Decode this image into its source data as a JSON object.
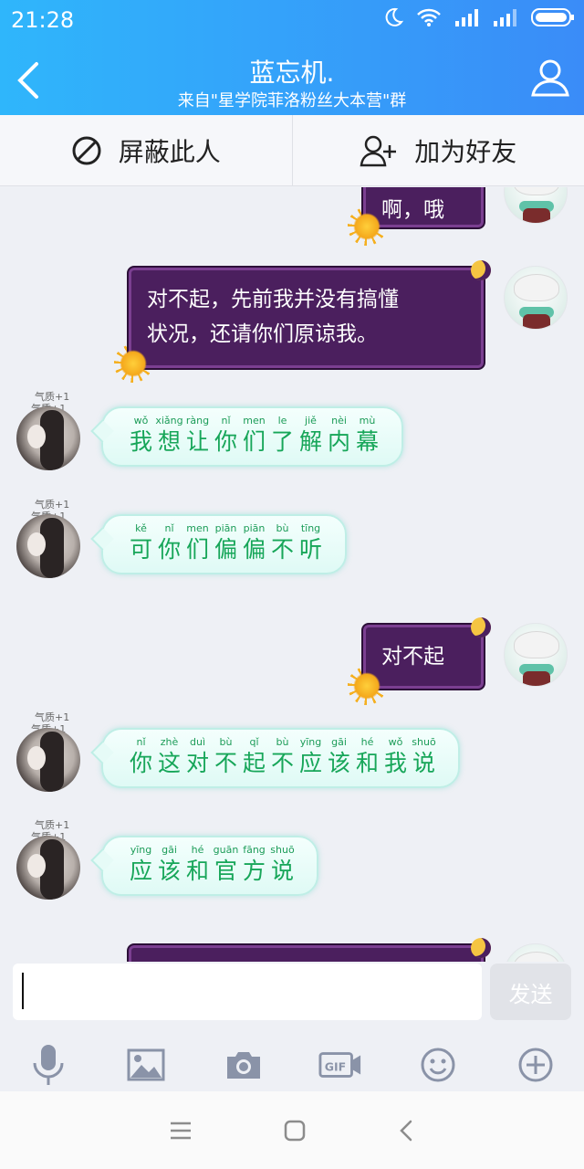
{
  "status_bar": {
    "time": "21:28"
  },
  "header": {
    "title": "蓝忘机.",
    "subtitle": "来自\"星学院菲洛粉丝大本营\"群"
  },
  "actions": {
    "block_label": "屏蔽此人",
    "add_friend_label": "加为好友"
  },
  "tags": [
    "气质+1",
    "气质+1"
  ],
  "messages": [
    {
      "side": "right",
      "text_line1": "啊，哦"
    },
    {
      "side": "right",
      "line1": "对不起，先前我并没有搞懂",
      "line2": "状况，还请你们原谅我。"
    },
    {
      "side": "left",
      "chars": [
        {
          "p": "wǒ",
          "h": "我"
        },
        {
          "p": "xiǎng",
          "h": "想"
        },
        {
          "p": "ràng",
          "h": "让"
        },
        {
          "p": "nǐ",
          "h": "你"
        },
        {
          "p": "men",
          "h": "们"
        },
        {
          "p": "le",
          "h": "了"
        },
        {
          "p": "jiě",
          "h": "解"
        },
        {
          "p": "nèi",
          "h": "内"
        },
        {
          "p": "mù",
          "h": "幕"
        }
      ]
    },
    {
      "side": "left",
      "chars": [
        {
          "p": "kě",
          "h": "可"
        },
        {
          "p": "nǐ",
          "h": "你"
        },
        {
          "p": "men",
          "h": "们"
        },
        {
          "p": "piān",
          "h": "偏"
        },
        {
          "p": "piān",
          "h": "偏"
        },
        {
          "p": "bù",
          "h": "不"
        },
        {
          "p": "tīng",
          "h": "听"
        }
      ]
    },
    {
      "side": "right",
      "text": "对不起"
    },
    {
      "side": "left",
      "chars": [
        {
          "p": "nǐ",
          "h": "你"
        },
        {
          "p": "zhè",
          "h": "这"
        },
        {
          "p": "duì",
          "h": "对"
        },
        {
          "p": "bù",
          "h": "不"
        },
        {
          "p": "qǐ",
          "h": "起"
        },
        {
          "p": "bù",
          "h": "不"
        },
        {
          "p": "yīng",
          "h": "应"
        },
        {
          "p": "gāi",
          "h": "该"
        },
        {
          "p": "hé",
          "h": "和"
        },
        {
          "p": "wǒ",
          "h": "我"
        },
        {
          "p": "shuō",
          "h": "说"
        }
      ]
    },
    {
      "side": "left",
      "chars": [
        {
          "p": "yīng",
          "h": "应"
        },
        {
          "p": "gāi",
          "h": "该"
        },
        {
          "p": "hé",
          "h": "和"
        },
        {
          "p": "guān",
          "h": "官"
        },
        {
          "p": "fāng",
          "h": "方"
        },
        {
          "p": "shuō",
          "h": "说"
        }
      ]
    }
  ],
  "input": {
    "value": "",
    "send_label": "发送"
  },
  "toolbar": {
    "icons": [
      "microphone-icon",
      "image-icon",
      "camera-icon",
      "gif-icon",
      "emoji-icon",
      "plus-icon"
    ],
    "gif_label": "GIF"
  },
  "colors": {
    "header_start": "#2fb6fb",
    "header_end": "#3a8cf8",
    "purple_bubble": "#4b1f5e",
    "pinyin_green": "#17a659"
  }
}
